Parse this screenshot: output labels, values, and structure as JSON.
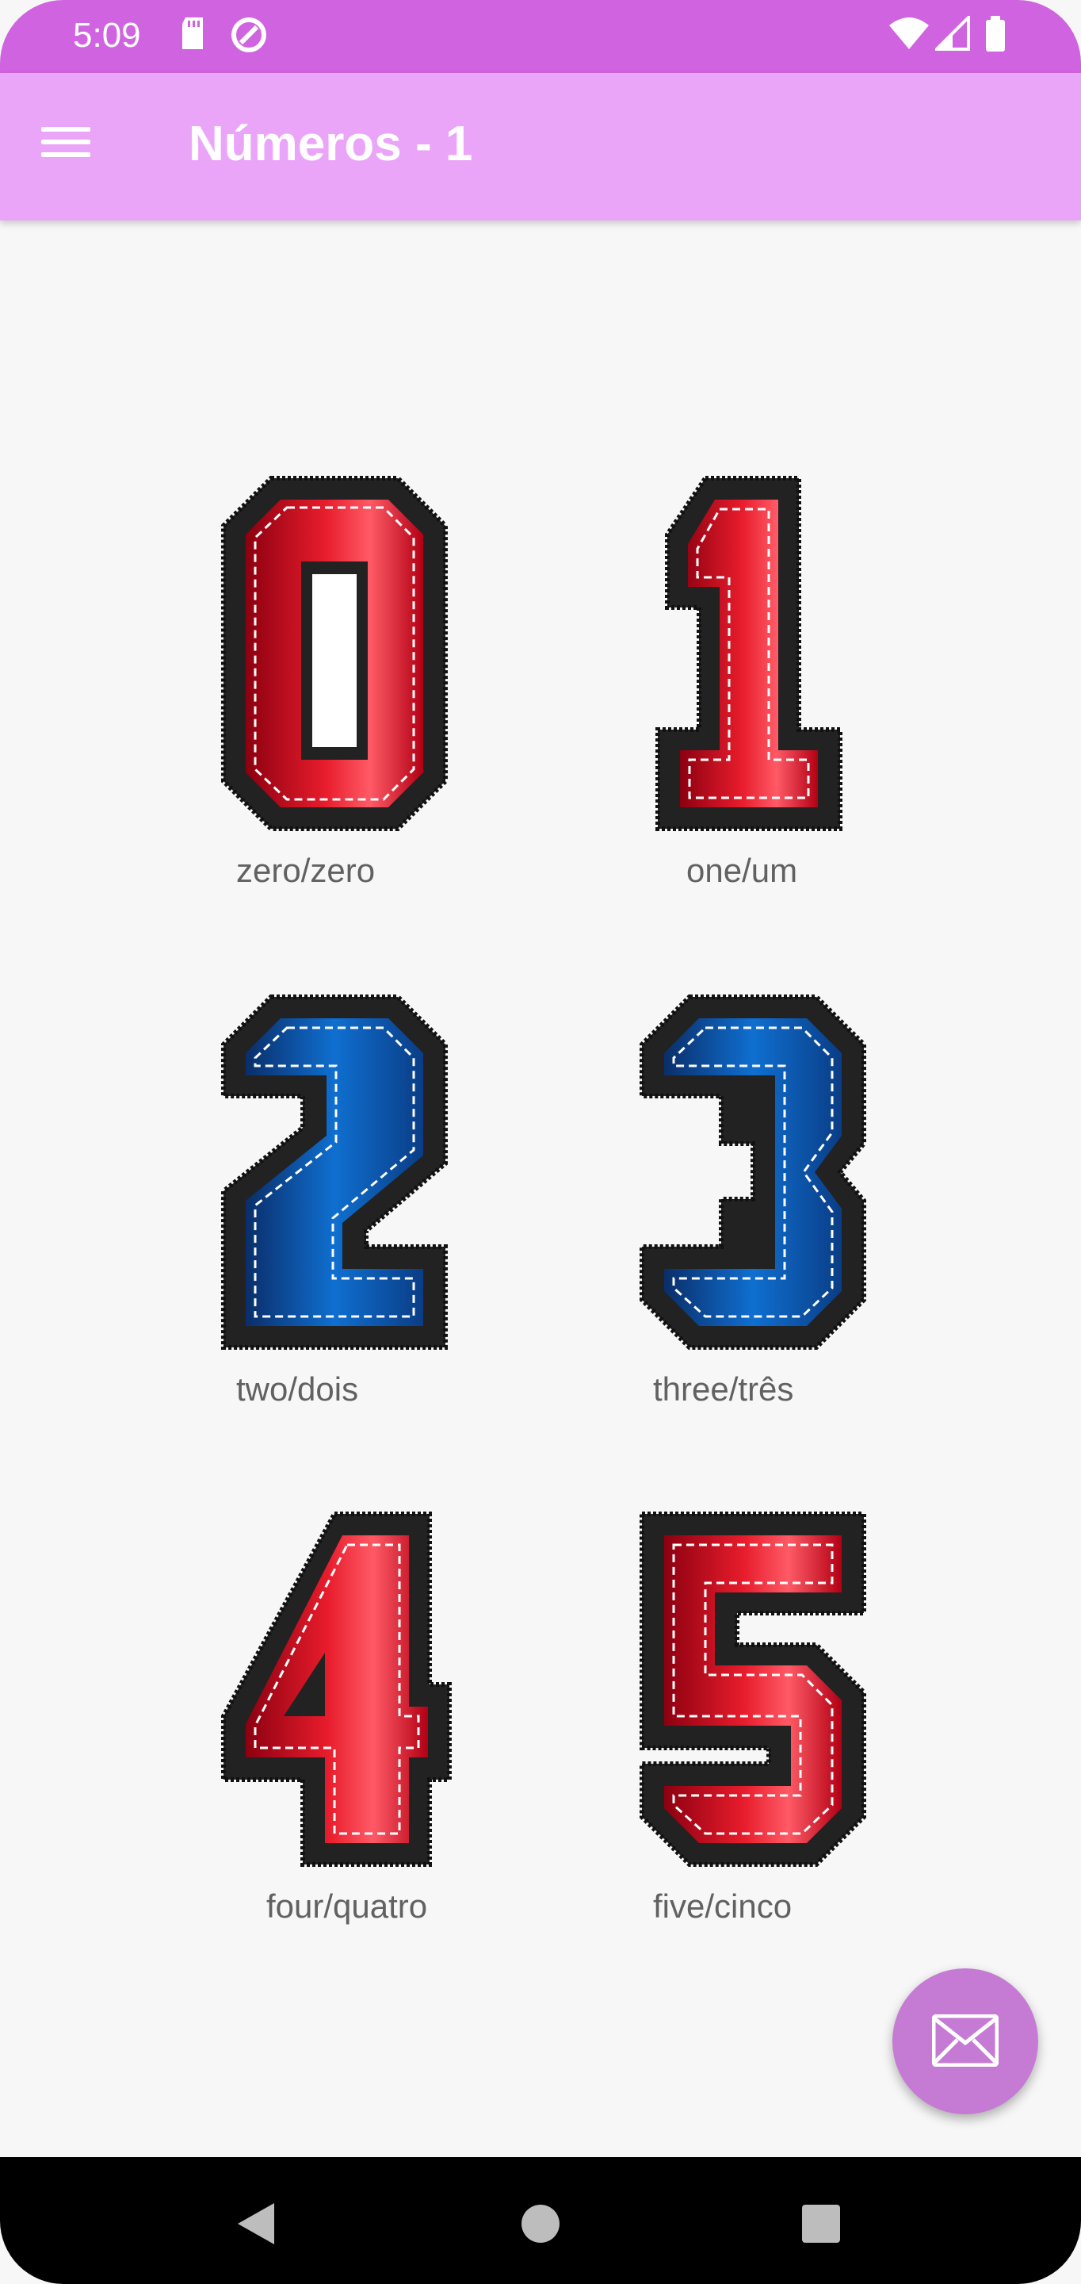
{
  "status_bar": {
    "time": "5:09",
    "icons": [
      "sd-card-icon",
      "sync-icon",
      "wifi-icon",
      "signal-icon",
      "battery-icon"
    ]
  },
  "app_bar": {
    "title": "Números - 1",
    "menu_icon": "hamburger-menu-icon"
  },
  "numbers": [
    {
      "digit": "0",
      "label": "zero/zero",
      "color": "red"
    },
    {
      "digit": "1",
      "label": "one/um",
      "color": "red"
    },
    {
      "digit": "2",
      "label": "two/dois",
      "color": "blue"
    },
    {
      "digit": "3",
      "label": "three/três",
      "color": "blue"
    },
    {
      "digit": "4",
      "label": "four/quatro",
      "color": "red"
    },
    {
      "digit": "5",
      "label": "five/cinco",
      "color": "red"
    }
  ],
  "fab": {
    "icon": "mail-icon"
  },
  "nav_bar": {
    "buttons": [
      "back-icon",
      "home-icon",
      "recents-icon"
    ]
  },
  "colors": {
    "status_bar": "#d063e0",
    "app_bar": "#eba5f8",
    "fab": "#c57ad4",
    "red_digit": "#e3162a",
    "blue_digit": "#1167c4"
  }
}
